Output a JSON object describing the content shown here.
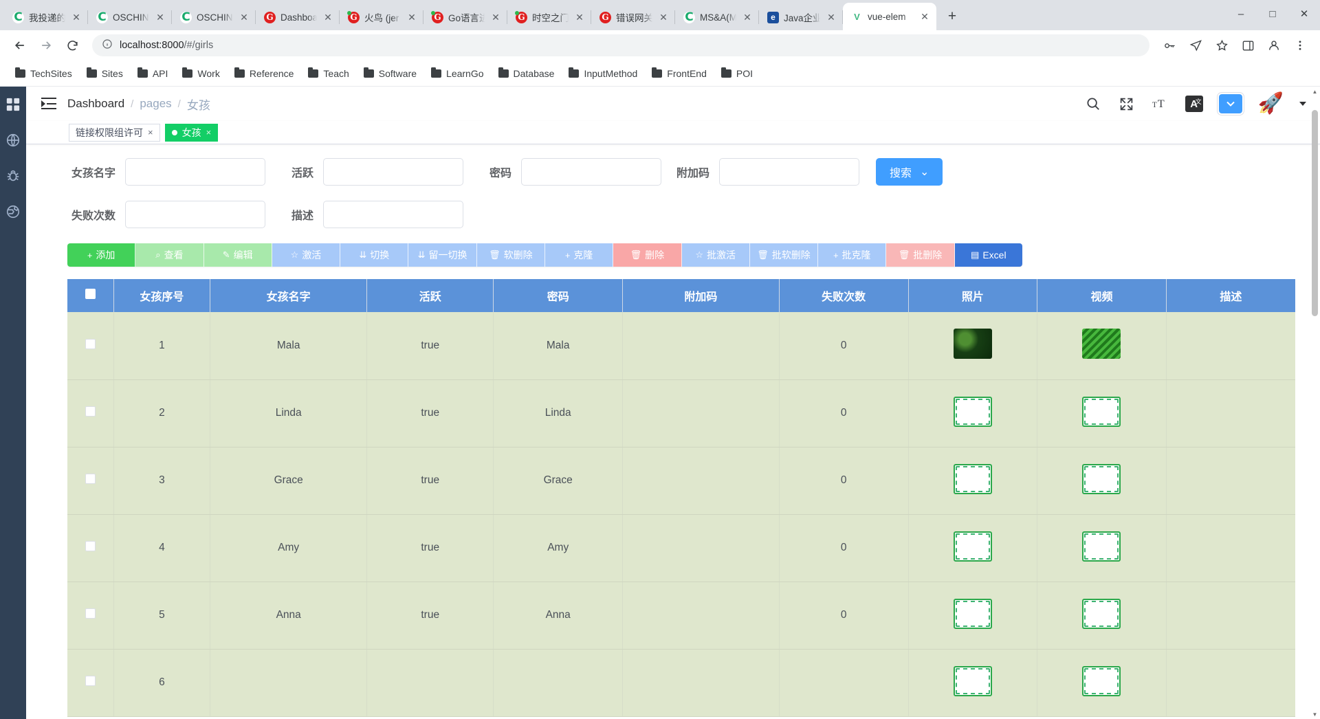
{
  "browser": {
    "tabs": [
      {
        "title": "我投递的",
        "icon": "chrome-c-icon",
        "kind": "c",
        "active": false
      },
      {
        "title": "OSCHINA",
        "icon": "chrome-c-icon",
        "kind": "c",
        "active": false
      },
      {
        "title": "OSCHINA",
        "icon": "chrome-c-icon",
        "kind": "c",
        "active": false
      },
      {
        "title": "Dashboa",
        "icon": "gitee-g-icon",
        "kind": "g",
        "active": false
      },
      {
        "title": "火鸟 (jer",
        "icon": "gitee-g-icon",
        "kind": "g2",
        "active": false
      },
      {
        "title": "Go语言进",
        "icon": "gitee-g-icon",
        "kind": "g2",
        "active": false
      },
      {
        "title": "时空之门",
        "icon": "gitee-g-icon",
        "kind": "g2",
        "active": false
      },
      {
        "title": "错误网关",
        "icon": "gitee-g-icon",
        "kind": "g",
        "active": false
      },
      {
        "title": "MS&A(M",
        "icon": "chrome-c-icon",
        "kind": "c",
        "active": false
      },
      {
        "title": "Java企业",
        "icon": "csdn-icon",
        "kind": "j",
        "active": false
      },
      {
        "title": "vue-elem",
        "icon": "vue-icon",
        "kind": "v",
        "active": true
      }
    ],
    "new_tab_label": "+",
    "window_controls": [
      "–",
      "□",
      "✕"
    ],
    "nav": {
      "back": "←",
      "forward": "→",
      "reload": "⟳",
      "info_icon": "ⓘ",
      "url_host": "localhost:8000",
      "url_path": "/#/girls",
      "key_icon": "🔑",
      "share_icon": "➤",
      "star_icon": "☆",
      "sidepanel_icon": "▯",
      "profile_icon": "👤",
      "menu_icon": "⋮"
    },
    "bookmarks": [
      "TechSites",
      "Sites",
      "API",
      "Work",
      "Reference",
      "Teach",
      "Software",
      "LearnGo",
      "Database",
      "InputMethod",
      "FrontEnd",
      "POI"
    ]
  },
  "app": {
    "rail_icons": [
      "grid-icon",
      "globe-icon",
      "bug-icon",
      "earth-icon"
    ],
    "navbar": {
      "menu_toggle": "collapse-menu-icon",
      "breadcrumb": [
        "Dashboard",
        "pages",
        "女孩"
      ],
      "separator": "/",
      "icons": {
        "search": "search-icon",
        "fullscreen": "fullscreen-icon",
        "font_size": "font-size-icon",
        "language": "A",
        "language_sup": "文",
        "theme": "theme-chevron-icon",
        "avatar": "🚀",
        "caret": "caret-down-icon"
      }
    },
    "tags": [
      {
        "label": "链接权限组许可",
        "active": false,
        "close": "×"
      },
      {
        "label": "女孩",
        "active": true,
        "close": "×"
      }
    ],
    "filters": {
      "row1": [
        {
          "label": "女孩名字",
          "value": "",
          "placeholder": ""
        },
        {
          "label": "活跃",
          "value": "",
          "placeholder": ""
        },
        {
          "label": "密码",
          "value": "",
          "placeholder": ""
        },
        {
          "label": "附加码",
          "value": "",
          "placeholder": ""
        }
      ],
      "row2": [
        {
          "label": "失败次数",
          "value": "",
          "placeholder": ""
        },
        {
          "label": "描述",
          "value": "",
          "placeholder": ""
        }
      ],
      "search_button": "搜索",
      "search_caret": "⌄"
    },
    "actions": [
      {
        "label": "添加",
        "icon": "+",
        "style": "g-solid"
      },
      {
        "label": "查看",
        "icon": "⌕",
        "style": "g-light"
      },
      {
        "label": "编辑",
        "icon": "✎",
        "style": "g-light"
      },
      {
        "label": "激活",
        "icon": "☆",
        "style": "b-light"
      },
      {
        "label": "切换",
        "icon": "⇊",
        "style": "b-light"
      },
      {
        "label": "留一切换",
        "icon": "⇊",
        "style": "b-light"
      },
      {
        "label": "软删除",
        "icon": "🗑",
        "style": "b-light"
      },
      {
        "label": "克隆",
        "icon": "+",
        "style": "b-light"
      },
      {
        "label": "删除",
        "icon": "🗑",
        "style": "r-light"
      },
      {
        "label": "批激活",
        "icon": "☆",
        "style": "b-light"
      },
      {
        "label": "批软删除",
        "icon": "🗑",
        "style": "b-light"
      },
      {
        "label": "批克隆",
        "icon": "+",
        "style": "b-light"
      },
      {
        "label": "批删除",
        "icon": "🗑",
        "style": "r-light2"
      },
      {
        "label": "Excel",
        "icon": "▤",
        "style": "b-solid"
      }
    ],
    "table": {
      "columns": [
        "",
        "女孩序号",
        "女孩名字",
        "活跃",
        "密码",
        "附加码",
        "失败次数",
        "照片",
        "视频",
        "描述"
      ],
      "rows": [
        {
          "id": "1",
          "name": "Mala",
          "active": "true",
          "password": "Mala",
          "extra": "",
          "fails": "0",
          "photo": "leaf",
          "video": "leaf2",
          "desc": ""
        },
        {
          "id": "2",
          "name": "Linda",
          "active": "true",
          "password": "Linda",
          "extra": "",
          "fails": "0",
          "photo": "blank",
          "video": "blank",
          "desc": ""
        },
        {
          "id": "3",
          "name": "Grace",
          "active": "true",
          "password": "Grace",
          "extra": "",
          "fails": "0",
          "photo": "blank",
          "video": "blank",
          "desc": ""
        },
        {
          "id": "4",
          "name": "Amy",
          "active": "true",
          "password": "Amy",
          "extra": "",
          "fails": "0",
          "photo": "blank",
          "video": "blank",
          "desc": ""
        },
        {
          "id": "5",
          "name": "Anna",
          "active": "true",
          "password": "Anna",
          "extra": "",
          "fails": "0",
          "photo": "blank",
          "video": "blank",
          "desc": ""
        },
        {
          "id": "6",
          "name": "",
          "active": "",
          "password": "",
          "extra": "",
          "fails": "",
          "photo": "blank",
          "video": "blank",
          "desc": ""
        }
      ]
    }
  },
  "colors": {
    "accent_blue": "#409eff",
    "table_header": "#5b92d9",
    "row_green": "#dfe7cd",
    "tag_green": "#13ce66",
    "rail_dark": "#304156",
    "btn_add_green": "#42d159"
  }
}
